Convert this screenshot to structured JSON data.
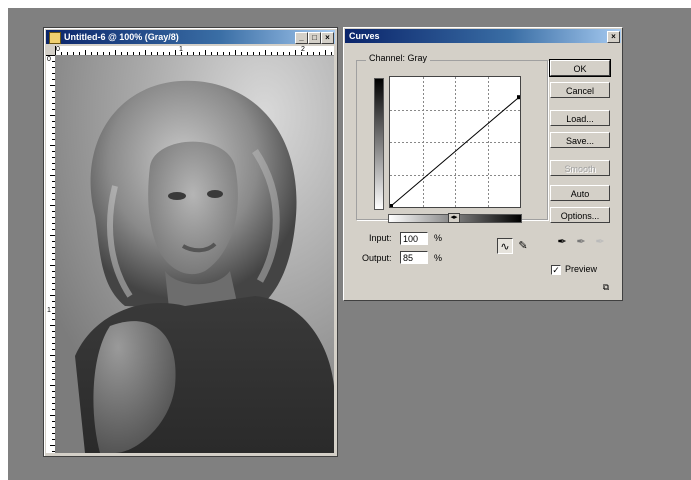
{
  "document_window": {
    "title": "Untitled-6 @ 100% (Gray/8)",
    "min_glyph": "_",
    "restore_glyph": "□",
    "close_glyph": "×",
    "ruler_top_numbers": [
      "0",
      "1",
      "2"
    ],
    "ruler_left_numbers": [
      "0",
      "1"
    ]
  },
  "curves_dialog": {
    "title": "Curves",
    "close_glyph": "×",
    "channel_legend": "Channel: Gray",
    "gradient_toggle_glyph": "◂▸",
    "input_label": "Input:",
    "input_value": "100",
    "input_unit": "%",
    "output_label": "Output:",
    "output_value": "85",
    "output_unit": "%",
    "curve_tool_glyph": "∿",
    "pencil_tool_glyph": "✎",
    "buttons": {
      "ok": "OK",
      "cancel": "Cancel",
      "load": "Load...",
      "save": "Save...",
      "smooth": "Smooth",
      "auto": "Auto",
      "options": "Options..."
    },
    "eyedropper_glyph": "✒",
    "preview_label": "Preview",
    "preview_checked": true,
    "preview_check_glyph": "✓",
    "expand_glyph": "⧉",
    "curve_points": [
      [
        0,
        0
      ],
      [
        100,
        85
      ]
    ]
  },
  "colors": {
    "workspace": "#808080",
    "titlebar_start": "#0a246a",
    "dialog_face": "#d4d0c8"
  }
}
